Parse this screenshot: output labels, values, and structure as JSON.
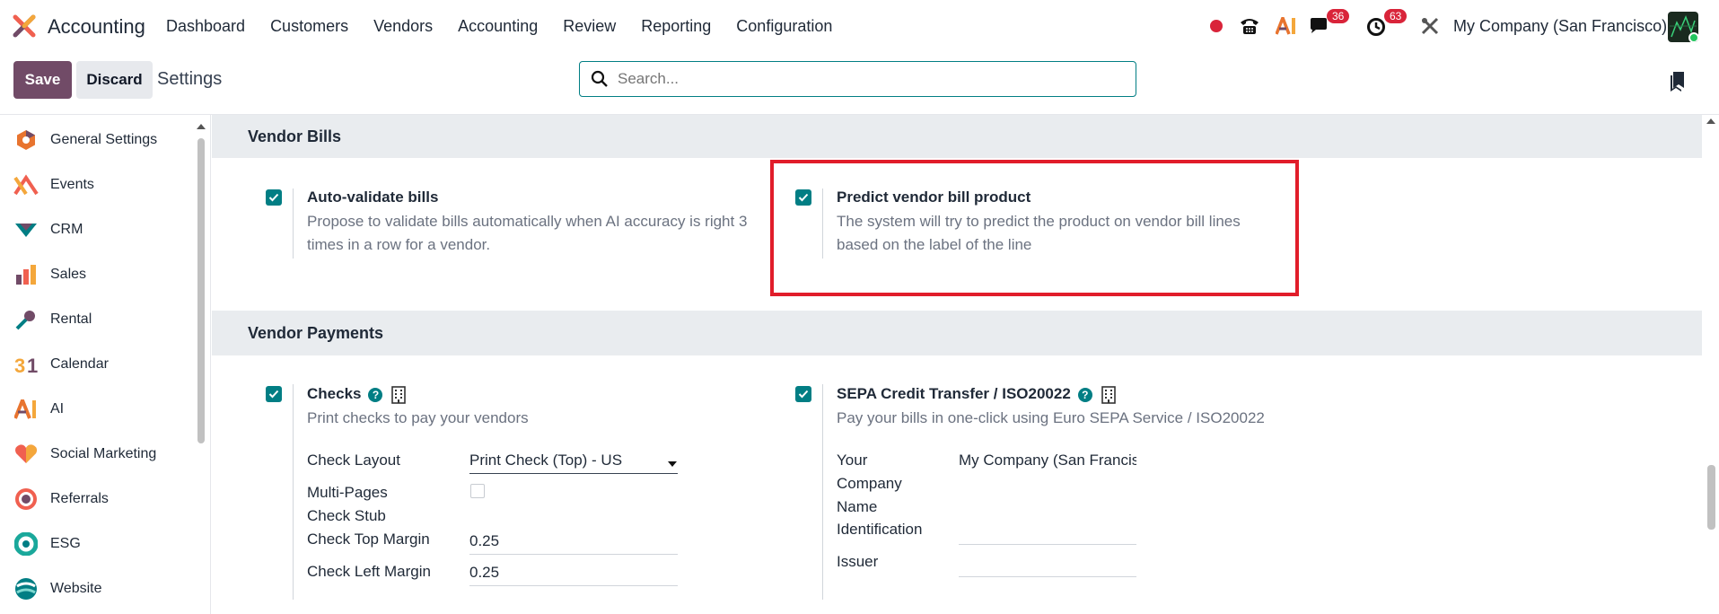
{
  "app": {
    "name": "Accounting"
  },
  "menu": [
    "Dashboard",
    "Customers",
    "Vendors",
    "Accounting",
    "Review",
    "Reporting",
    "Configuration"
  ],
  "systray": {
    "messages_count": "36",
    "activities_count": "63",
    "company": "My Company (San Francisco)"
  },
  "control": {
    "save_label": "Save",
    "discard_label": "Discard",
    "title": "Settings",
    "search_placeholder": "Search..."
  },
  "sidebar": {
    "items": [
      {
        "label": "General Settings",
        "icon": "general-settings-icon"
      },
      {
        "label": "Events",
        "icon": "events-icon"
      },
      {
        "label": "CRM",
        "icon": "crm-icon"
      },
      {
        "label": "Sales",
        "icon": "sales-icon"
      },
      {
        "label": "Rental",
        "icon": "rental-icon"
      },
      {
        "label": "Calendar",
        "icon": "calendar-icon"
      },
      {
        "label": "AI",
        "icon": "ai-icon"
      },
      {
        "label": "Social Marketing",
        "icon": "social-marketing-icon"
      },
      {
        "label": "Referrals",
        "icon": "referrals-icon"
      },
      {
        "label": "ESG",
        "icon": "esg-icon"
      },
      {
        "label": "Website",
        "icon": "website-icon"
      }
    ]
  },
  "vendor_bills": {
    "heading": "Vendor Bills",
    "auto_validate": {
      "title": "Auto-validate bills",
      "desc": "Propose to validate bills automatically when AI accuracy is right 3 times in a row for a vendor.",
      "checked": true
    },
    "predict_product": {
      "title": "Predict vendor bill product",
      "desc": "The system will try to predict the product on vendor bill lines based on the label of the line",
      "checked": true
    }
  },
  "vendor_payments": {
    "heading": "Vendor Payments",
    "checks": {
      "title": "Checks",
      "desc": "Print checks to pay your vendors",
      "checked": true,
      "check_layout_label": "Check Layout",
      "check_layout_value": "Print Check (Top) - US",
      "multi_pages_label": "Multi-Pages",
      "check_stub_label": "Check Stub",
      "multi_pages_checked": false,
      "top_margin_label": "Check Top Margin",
      "top_margin_value": "0.25",
      "left_margin_label": "Check Left Margin",
      "left_margin_value": "0.25"
    },
    "sepa": {
      "title": "SEPA Credit Transfer / ISO20022",
      "desc": "Pay your bills in one-click using Euro SEPA Service / ISO20022",
      "checked": true,
      "company_name_label_1": "Your",
      "company_name_label_2": "Company",
      "company_name_label_3": "Name",
      "company_name_value": "My Company (San Francis",
      "identification_label": "Identification",
      "issuer_label": "Issuer",
      "identification_value": "",
      "issuer_value": ""
    }
  },
  "colors": {
    "primary": "#714b67",
    "accent": "#017e84",
    "highlight": "#e11d2a",
    "badge": "#d9243a"
  }
}
